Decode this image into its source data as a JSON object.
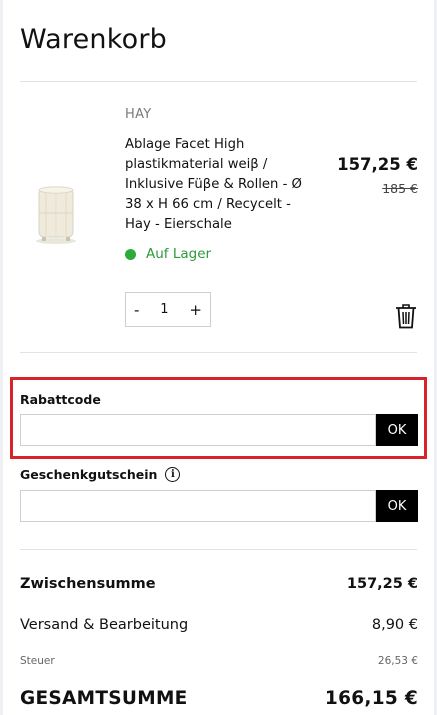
{
  "cart": {
    "title": "Warenkorb"
  },
  "item": {
    "brand": "HAY",
    "name": "Ablage Facet High plastikmaterial weiβ / Inklusive Füβe & Rollen - Ø 38 x H 66 cm / Recycelt - Hay - Eierschale",
    "price": "157,25 €",
    "old_price": "185 €",
    "stock_status": "Auf Lager",
    "stock_color": "#2eaa3a",
    "quantity": "1",
    "qty_minus": "-",
    "qty_plus": "+",
    "image_icon": "product-thumbnail",
    "delete_icon": "trash-icon"
  },
  "discount": {
    "label": "Rabattcode",
    "value": "",
    "placeholder": "",
    "button_label": "OK",
    "highlight_color": "#d8232a"
  },
  "gift_card": {
    "label": "Geschenkgutschein",
    "info_icon": "info-icon",
    "value": "",
    "placeholder": "",
    "button_label": "OK"
  },
  "summary": {
    "subtotal_label": "Zwischensumme",
    "subtotal_value": "157,25 €",
    "shipping_label": "Versand & Bearbeitung",
    "shipping_value": "8,90 €",
    "tax_label": "Steuer",
    "tax_value": "26,53 €",
    "total_label": "GESAMTSUMME",
    "total_value": "166,15 €"
  }
}
